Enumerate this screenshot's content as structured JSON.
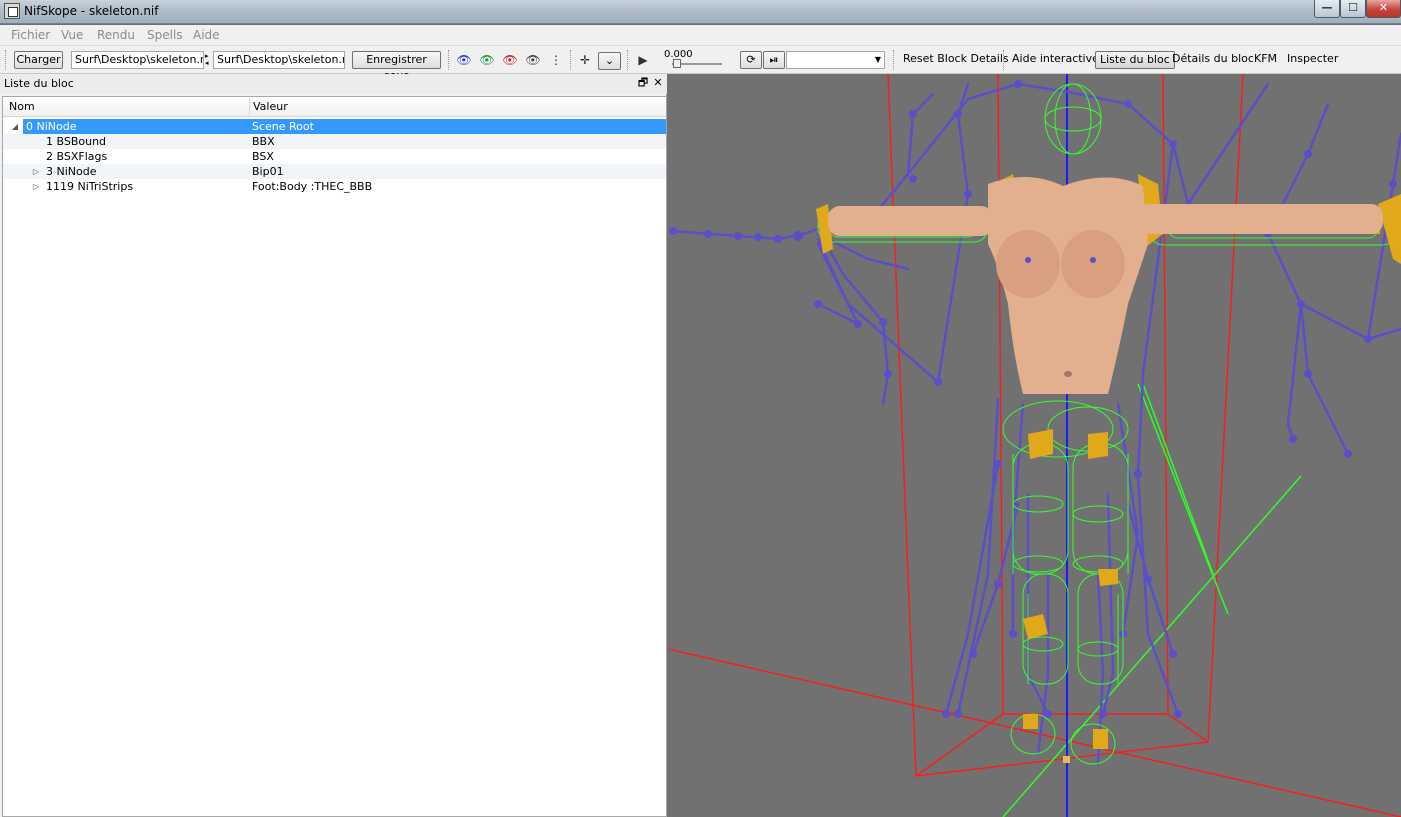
{
  "window": {
    "title": "NifSkope - skeleton.nif",
    "min": "—",
    "max": "☐",
    "close": "✕"
  },
  "menu": [
    "Fichier",
    "Vue",
    "Rendu",
    "Spells",
    "Aide"
  ],
  "toolbar": {
    "load_label": "Charger",
    "load_path": "Surf\\Desktop\\skeleton.nif",
    "save_path": "Surf\\Desktop\\skeleton.nif",
    "save_as_label": "Enregistrer sous",
    "time_value": "0.000",
    "links": [
      "Reset Block Details",
      "Aide interactive",
      "Liste du bloc",
      "Détails du bloc",
      "KFM",
      "Inspecter"
    ],
    "active_link": "Liste du bloc"
  },
  "dock": {
    "title": "Liste du bloc",
    "float_icon": "🗗",
    "close_icon": "✕",
    "columns": [
      "Nom",
      "Valeur"
    ],
    "rows": [
      {
        "name": "0 NiNode",
        "value": "Scene Root",
        "depth": 0,
        "expander": "expanded",
        "selected": true
      },
      {
        "name": "1 BSBound",
        "value": "BBX",
        "depth": 1,
        "expander": "none",
        "selected": false
      },
      {
        "name": "2 BSXFlags",
        "value": "BSX",
        "depth": 1,
        "expander": "none",
        "selected": false
      },
      {
        "name": "3 NiNode",
        "value": "Bip01",
        "depth": 1,
        "expander": "collapsed",
        "selected": false
      },
      {
        "name": "1119 NiTriStrips",
        "value": "Foot:Body :THEC_BBB",
        "depth": 1,
        "expander": "collapsed",
        "selected": false
      }
    ]
  },
  "colors": {
    "selection": "#3399ff",
    "viewport_bg": "#717171",
    "bone": "#5b4fc9",
    "collision_wire": "#36ff2e",
    "bounding_box": "#ff1a1a",
    "skin": "#e2b08f",
    "axis_blue": "#1a1aff"
  }
}
